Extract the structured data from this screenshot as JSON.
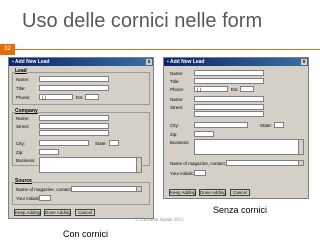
{
  "slide": {
    "title": "Uso delle cornici nelle form",
    "number": "32",
    "caption_left": "Con cornici",
    "caption_right": "Senza cornici",
    "footer": "© Giovanni Aprile 2015"
  },
  "dialog": {
    "title": "Add New Lead",
    "close_glyph": "x",
    "sections": {
      "lead": "Lead",
      "company": "Company",
      "source": "Source"
    },
    "labels": {
      "name": "Name:",
      "title": "Title:",
      "phone": "Phone:",
      "ext": "Ext.",
      "phone_sep": "(    )",
      "name2": "Name:",
      "street": "Street:",
      "city": "City:",
      "state": "State:",
      "zip": "Zip:",
      "business": "Business:",
      "source_name": "Name of magazine, contact, etc.:",
      "initials": "Your initials:"
    },
    "buttons": {
      "keep": "Keep Adding",
      "done": "Done Adding",
      "cancel": "Cancel"
    }
  },
  "colors": {
    "accent": "#e46c0a",
    "titlebar": "#0a246a",
    "dialog_bg": "#d4d0c8"
  }
}
